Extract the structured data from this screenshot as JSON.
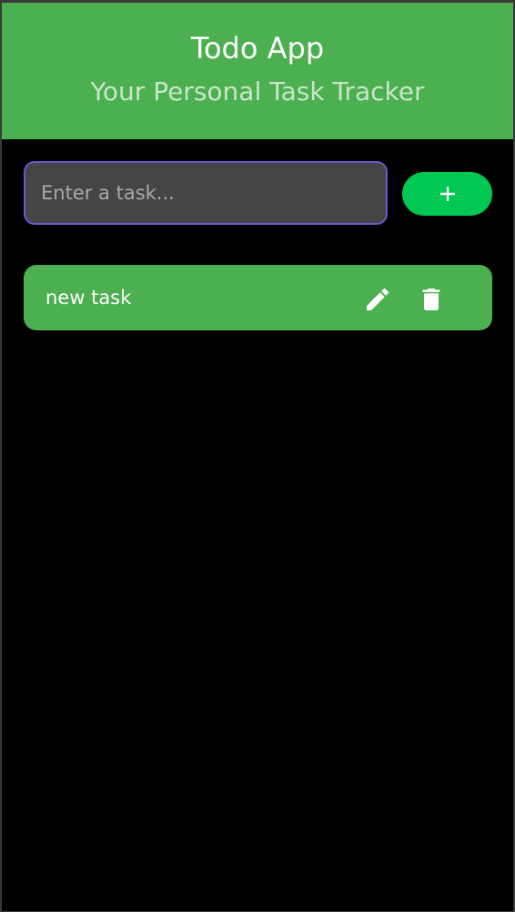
{
  "header": {
    "title": "Todo App",
    "subtitle": "Your Personal Task Tracker"
  },
  "input": {
    "placeholder": "Enter a task...",
    "value": ""
  },
  "add_button": {
    "icon": "plus-icon",
    "label": "+"
  },
  "tasks": [
    {
      "text": "new task",
      "edit_icon": "pencil-icon",
      "delete_icon": "trash-icon"
    }
  ],
  "colors": {
    "header_bg": "#4caf50",
    "subtitle": "#c8e6c9",
    "background": "#000000",
    "input_bg": "#454545",
    "input_border": "#6a5acd",
    "add_button_bg": "#00c853",
    "task_bg": "#4caf50"
  }
}
